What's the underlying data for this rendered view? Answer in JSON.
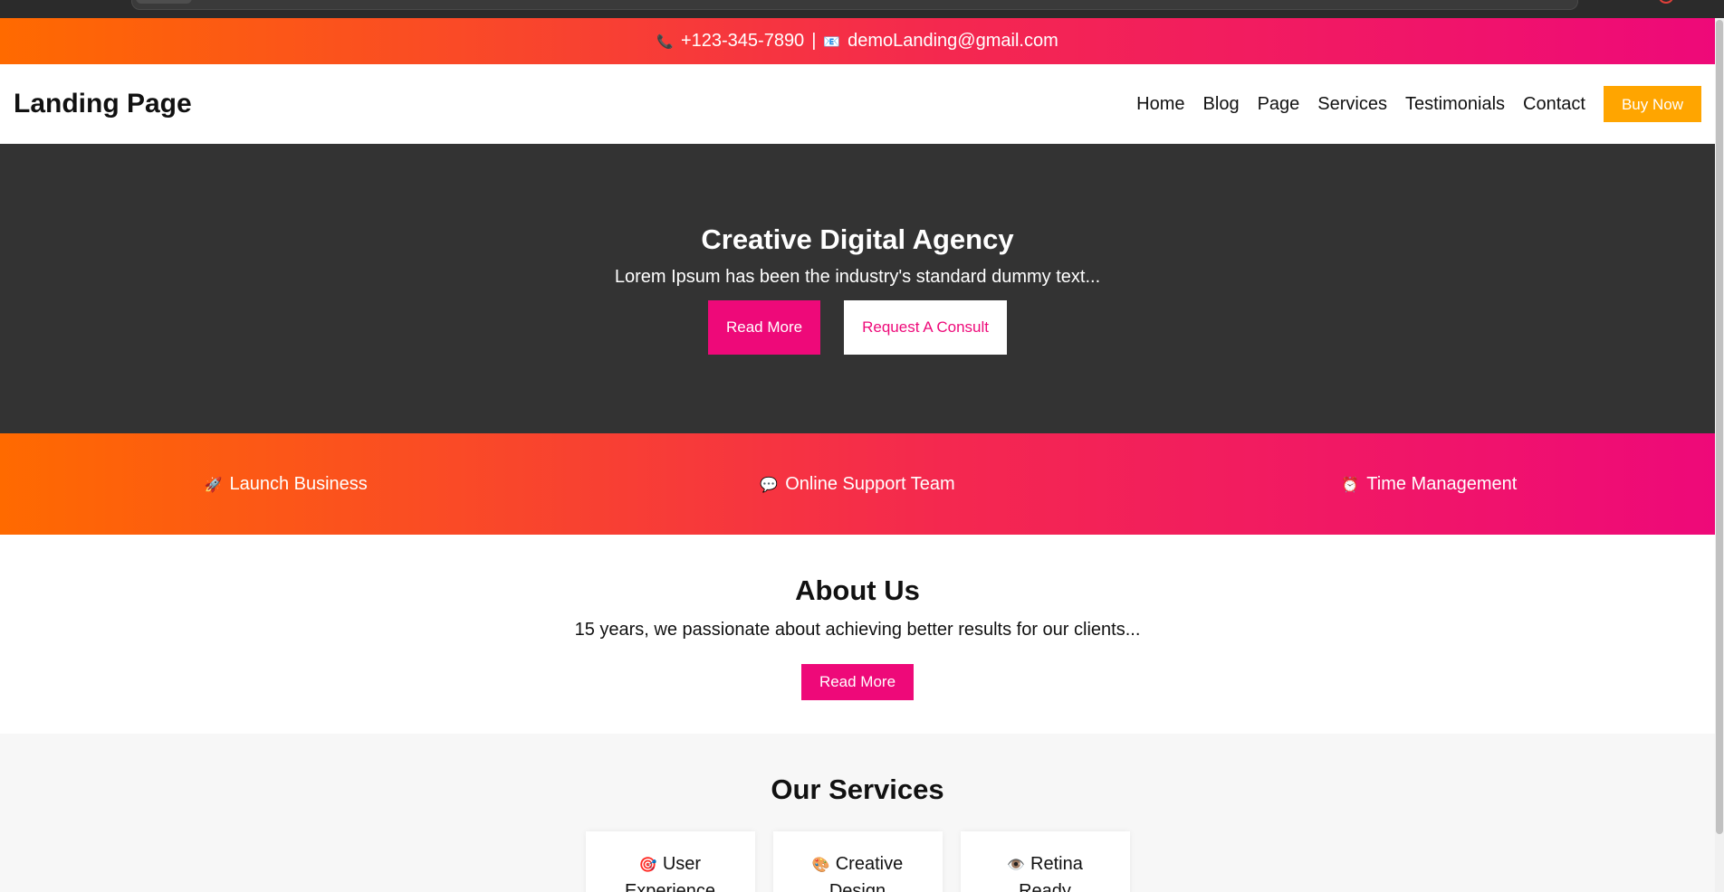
{
  "topbar": {
    "phone_icon": "📞",
    "phone": "+123-345-7890",
    "separator": "|",
    "email_icon": "📧",
    "email": "demoLanding@gmail.com"
  },
  "header": {
    "logo": "Landing Page",
    "nav": [
      "Home",
      "Blog",
      "Page",
      "Services",
      "Testimonials",
      "Contact"
    ],
    "buy_label": "Buy Now"
  },
  "hero": {
    "title": "Creative Digital Agency",
    "subtitle": "Lorem Ipsum has been the industry's standard dummy text...",
    "read_more": "Read More",
    "consult": "Request A Consult"
  },
  "features": [
    {
      "icon": "🚀",
      "label": "Launch Business"
    },
    {
      "icon": "💬",
      "label": "Online Support Team"
    },
    {
      "icon": "⏰",
      "label": "Time Management"
    }
  ],
  "about": {
    "title": "About Us",
    "text": "15 years, we passionate about achieving better results for our clients...",
    "read_more": "Read More"
  },
  "services": {
    "title": "Our Services",
    "cards": [
      {
        "icon": "🎯",
        "label": "User Experience"
      },
      {
        "icon": "🎨",
        "label": "Creative Design"
      },
      {
        "icon": "👁️",
        "label": "Retina Ready"
      }
    ]
  },
  "colors": {
    "accent": "#ee0979",
    "gradient_start": "#ff6a00",
    "gradient_end": "#ee0979",
    "buy_button": "#ffa500",
    "hero_bg": "#333333"
  }
}
